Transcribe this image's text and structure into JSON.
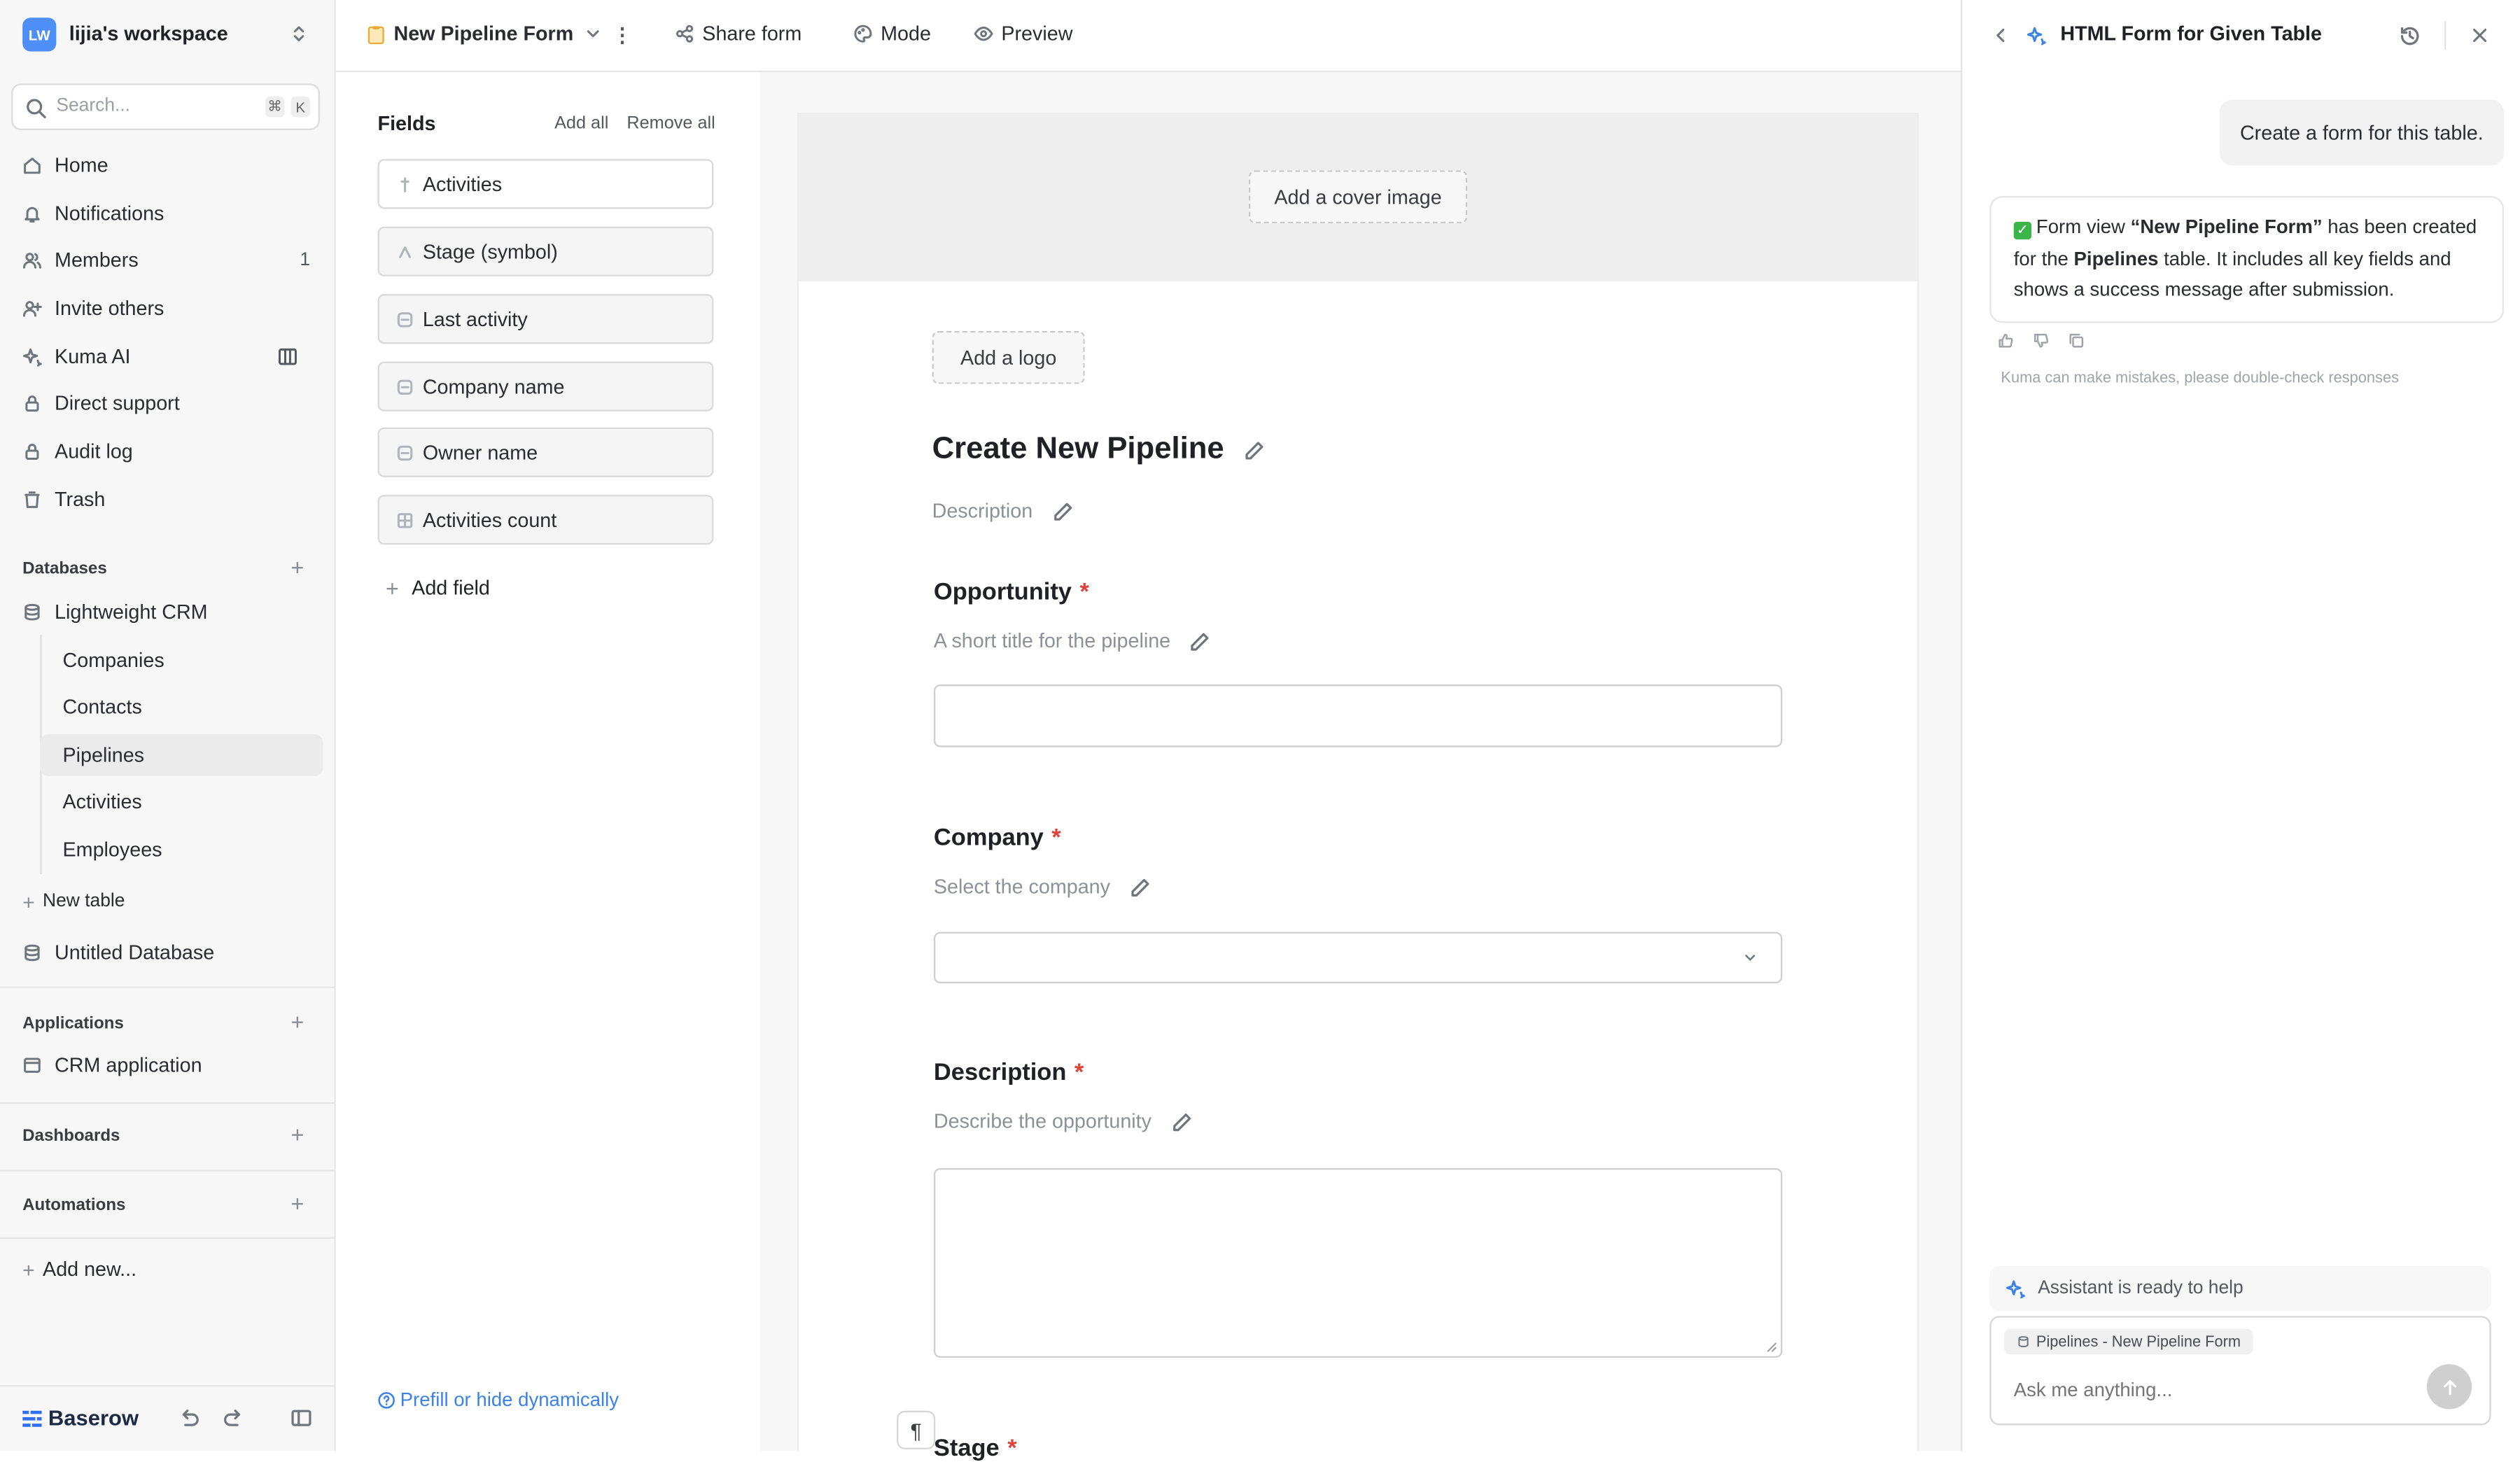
{
  "workspace": {
    "badge": "LW",
    "name": "lijia's workspace"
  },
  "search": {
    "placeholder": "Search...",
    "shortcut_mod": "⌘",
    "shortcut_key": "K"
  },
  "nav": [
    {
      "label": "Home",
      "icon": "home-icon"
    },
    {
      "label": "Notifications",
      "icon": "bell-icon"
    },
    {
      "label": "Members",
      "icon": "members-icon",
      "count": "1"
    },
    {
      "label": "Invite others",
      "icon": "user-plus-icon"
    },
    {
      "label": "Kuma AI",
      "icon": "sparkle-icon"
    },
    {
      "label": "Direct support",
      "icon": "lock-icon"
    },
    {
      "label": "Audit log",
      "icon": "lock-icon"
    },
    {
      "label": "Trash",
      "icon": "trash-icon"
    }
  ],
  "databases": {
    "heading": "Databases",
    "items": [
      {
        "label": "Lightweight CRM",
        "tables": [
          "Companies",
          "Contacts",
          "Pipelines",
          "Activities",
          "Employees"
        ]
      },
      {
        "label": "Untitled Database",
        "tables": []
      }
    ],
    "active_table": "Pipelines",
    "new_table_label": "New table"
  },
  "applications": {
    "heading": "Applications",
    "items": [
      "CRM application"
    ]
  },
  "dashboards": {
    "heading": "Dashboards"
  },
  "automations": {
    "heading": "Automations"
  },
  "add_new_label": "Add new...",
  "brand": "Baserow",
  "topbar": {
    "form_name": "New Pipeline Form",
    "share_label": "Share form",
    "mode_label": "Mode",
    "preview_label": "Preview"
  },
  "fields_panel": {
    "title": "Fields",
    "add_all": "Add all",
    "remove_all": "Remove all",
    "fields": [
      "Activities",
      "Stage (symbol)",
      "Last activity",
      "Company name",
      "Owner name",
      "Activities count"
    ],
    "add_field": "Add field",
    "prefill_link": "Prefill or hide dynamically"
  },
  "form": {
    "cover_label": "Add a cover image",
    "logo_label": "Add a logo",
    "title": "Create New Pipeline",
    "description_placeholder": "Description",
    "questions": [
      {
        "title": "Opportunity",
        "required": "*",
        "description": "A short title for the pipeline",
        "type": "text"
      },
      {
        "title": "Company",
        "required": "*",
        "description": "Select the company",
        "type": "select"
      },
      {
        "title": "Description",
        "required": "*",
        "description": "Describe the opportunity",
        "type": "textarea"
      },
      {
        "title": "Stage",
        "required": "*",
        "description": "",
        "type": "partial"
      }
    ]
  },
  "assistant": {
    "title": "HTML Form for Given Table",
    "user_message": "Create a form for this table.",
    "ai_message": {
      "check": "✓",
      "part1": "Form view ",
      "form_name": "“New Pipeline Form”",
      "part2": " has been created for the ",
      "table_name": "Pipelines",
      "part3": " table. It includes all key fields and shows a success message after submission."
    },
    "disclaimer": "Kuma can make mistakes, please double-check responses",
    "ready_text": "Assistant is ready to help",
    "context_chip": "Pipelines - New Pipeline Form",
    "input_placeholder": "Ask me anything..."
  }
}
